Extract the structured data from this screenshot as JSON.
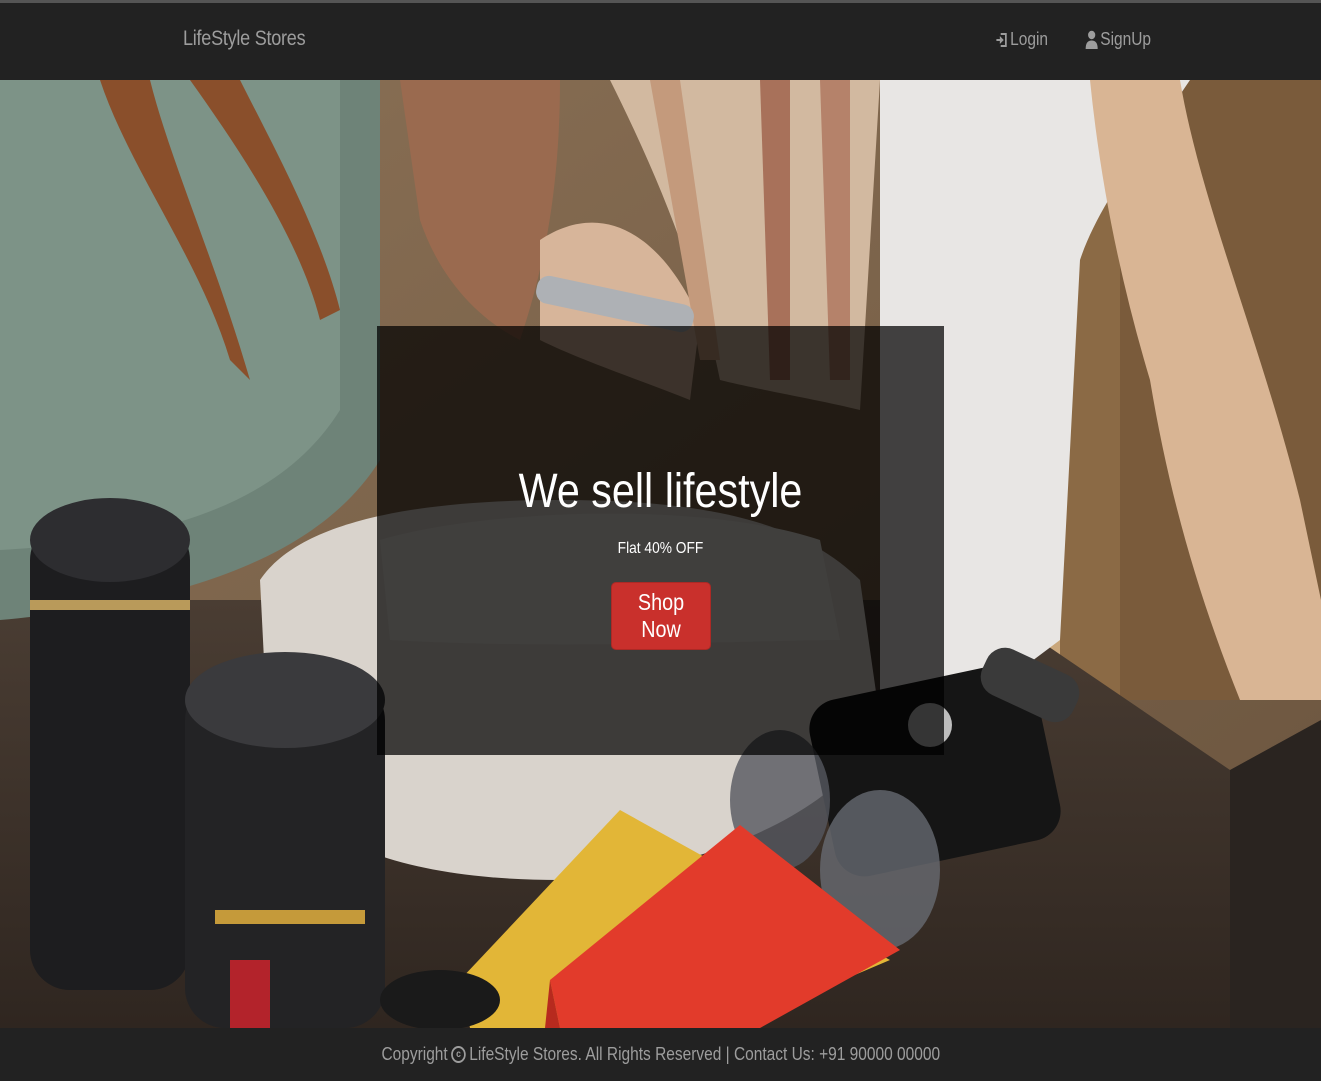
{
  "navbar": {
    "brand": "LifeStyle Stores",
    "login_label": "Login",
    "login_icon": "log-in-icon",
    "signup_label": "SignUp",
    "signup_icon": "user-icon"
  },
  "banner": {
    "title": "We sell lifestyle",
    "subtitle": "Flat 40% OFF",
    "button_label": "Shop Now",
    "button_color": "#c9302c"
  },
  "footer": {
    "prefix": "Copyright",
    "copyright_icon": "copyright-icon",
    "text": "LifeStyle Stores. All Rights Reserved | Contact Us: +91 90000 00000"
  },
  "colors": {
    "navbar_bg": "#222222",
    "nav_text": "#9d9d9d",
    "banner_overlay": "rgba(0,0,0,0.72)"
  }
}
